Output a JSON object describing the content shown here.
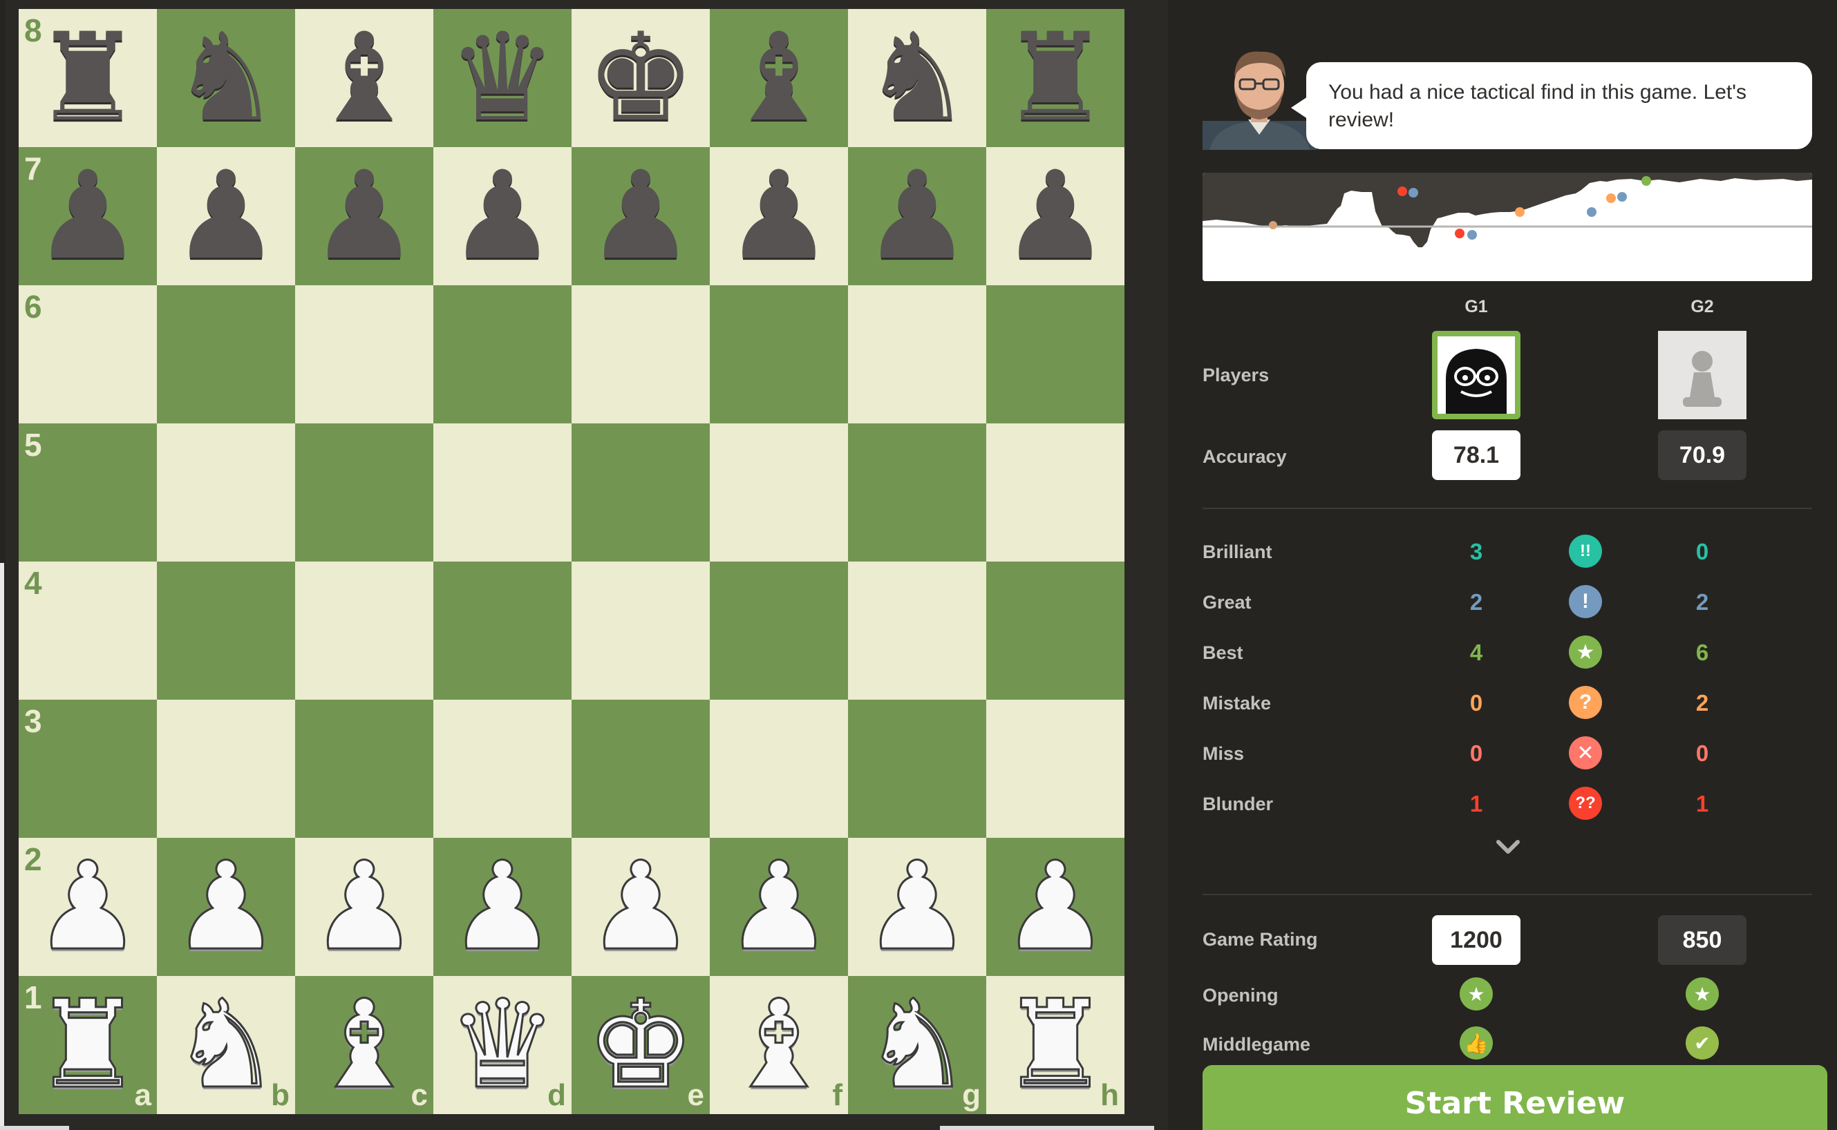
{
  "board": {
    "ranks": [
      "8",
      "7",
      "6",
      "5",
      "4",
      "3",
      "2",
      "1"
    ],
    "files": [
      "a",
      "b",
      "c",
      "d",
      "e",
      "f",
      "g",
      "h"
    ],
    "black_back": [
      "♜",
      "♞",
      "♝",
      "♛",
      "♚",
      "♝",
      "♞",
      "♜"
    ],
    "black_back_names": [
      "black-rook-icon",
      "black-knight-icon",
      "black-bishop-icon",
      "black-queen-icon",
      "black-king-icon",
      "black-bishop-icon",
      "black-knight-icon",
      "black-rook-icon"
    ],
    "pawn_black": "♟",
    "pawn_white": "♟",
    "white_back": [
      "♜",
      "♞",
      "♝",
      "♛",
      "♚",
      "♝",
      "♞",
      "♜"
    ],
    "white_back_names": [
      "white-rook-icon",
      "white-knight-icon",
      "white-bishop-icon",
      "white-queen-icon",
      "white-king-icon",
      "white-bishop-icon",
      "white-knight-icon",
      "white-rook-icon"
    ]
  },
  "coach": {
    "message": "You had a nice tactical find in this game. Let's review!"
  },
  "players": {
    "label": "Players",
    "g1": "G1",
    "g2": "G2"
  },
  "accuracy": {
    "label": "Accuracy",
    "g1": "78.1",
    "g2": "70.9"
  },
  "classifications": [
    {
      "label": "Brilliant",
      "g1": "3",
      "g2": "0",
      "color": "#26c2a3",
      "icon": "!!",
      "icon_name": "brilliant-icon"
    },
    {
      "label": "Great",
      "g1": "2",
      "g2": "2",
      "color": "#749bbf",
      "icon": "!",
      "icon_name": "great-icon"
    },
    {
      "label": "Best",
      "g1": "4",
      "g2": "6",
      "color": "#81b64c",
      "icon": "★",
      "icon_name": "best-star-icon"
    },
    {
      "label": "Mistake",
      "g1": "0",
      "g2": "2",
      "color": "#ffa459",
      "icon": "?",
      "icon_name": "mistake-icon"
    },
    {
      "label": "Miss",
      "g1": "0",
      "g2": "0",
      "color": "#ff7769",
      "icon": "✕",
      "icon_name": "miss-icon"
    },
    {
      "label": "Blunder",
      "g1": "1",
      "g2": "1",
      "color": "#fa412d",
      "icon": "??",
      "icon_name": "blunder-icon"
    }
  ],
  "game_rating": {
    "label": "Game Rating",
    "g1": "1200",
    "g2": "850"
  },
  "phases": [
    {
      "label": "Opening",
      "g1_icon": "★",
      "g1_name": "best-star-icon",
      "g1_color": "#81b64c",
      "g2_icon": "★",
      "g2_name": "best-star-icon",
      "g2_color": "#81b64c"
    },
    {
      "label": "Middlegame",
      "g1_icon": "👍",
      "g1_name": "thumbs-up-icon",
      "g1_color": "#81b64c",
      "g2_icon": "✔",
      "g2_name": "check-icon",
      "g2_color": "#96bc4b"
    }
  ],
  "actions": {
    "start_review": "Start Review"
  },
  "colors": {
    "board_light": "#ebecd0",
    "board_dark": "#739552",
    "panel_bg": "#262421",
    "accent_green": "#81b64c"
  }
}
